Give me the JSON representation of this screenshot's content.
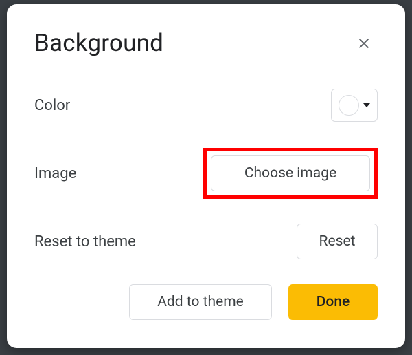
{
  "dialog": {
    "title": "Background",
    "rows": {
      "color": {
        "label": "Color"
      },
      "image": {
        "label": "Image",
        "button": "Choose image"
      },
      "reset": {
        "label": "Reset to theme",
        "button": "Reset"
      }
    },
    "footer": {
      "add_to_theme": "Add to theme",
      "done": "Done"
    },
    "colors": {
      "accent": "#fbbc04",
      "highlight": "#ff0000"
    }
  }
}
